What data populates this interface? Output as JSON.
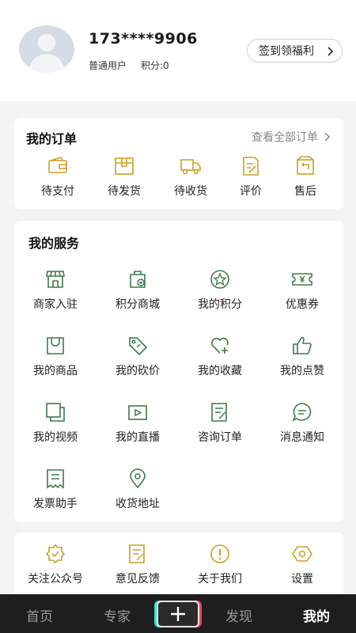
{
  "profile": {
    "phone": "173****9906",
    "role": "普通用户",
    "points": "积分:0",
    "signin_label": "签到领福利"
  },
  "orders": {
    "title": "我的订单",
    "view_all": "查看全部订单",
    "items": [
      {
        "label": "待支付",
        "icon": "wallet-icon"
      },
      {
        "label": "待发货",
        "icon": "box-icon"
      },
      {
        "label": "待收货",
        "icon": "truck-icon"
      },
      {
        "label": "评价",
        "icon": "review-icon"
      },
      {
        "label": "售后",
        "icon": "after-sale-icon"
      }
    ]
  },
  "services": {
    "title": "我的服务",
    "items": [
      {
        "label": "商家入驻",
        "icon": "store-icon"
      },
      {
        "label": "积分商城",
        "icon": "points-mall-icon"
      },
      {
        "label": "我的积分",
        "icon": "star-circle-icon"
      },
      {
        "label": "优惠券",
        "icon": "coupon-icon"
      },
      {
        "label": "我的商品",
        "icon": "bag-icon"
      },
      {
        "label": "我的砍价",
        "icon": "price-tag-icon"
      },
      {
        "label": "我的收藏",
        "icon": "heart-plus-icon"
      },
      {
        "label": "我的点赞",
        "icon": "thumbs-up-icon"
      },
      {
        "label": "我的视频",
        "icon": "video-icon"
      },
      {
        "label": "我的直播",
        "icon": "live-icon"
      },
      {
        "label": "咨询订单",
        "icon": "consult-order-icon"
      },
      {
        "label": "消息通知",
        "icon": "message-icon"
      },
      {
        "label": "发票助手",
        "icon": "invoice-icon"
      },
      {
        "label": "收货地址",
        "icon": "location-icon"
      }
    ]
  },
  "more": {
    "items": [
      {
        "label": "关注公众号",
        "icon": "badge-icon"
      },
      {
        "label": "意见反馈",
        "icon": "feedback-icon"
      },
      {
        "label": "关于我们",
        "icon": "info-icon"
      },
      {
        "label": "设置",
        "icon": "settings-icon"
      }
    ]
  },
  "tabbar": {
    "home": "首页",
    "experts": "专家",
    "discover": "发现",
    "mine": "我的"
  },
  "colors": {
    "gold": "#c9a227",
    "green": "#3f7a4a",
    "tabbar_bg": "#1e1e1e"
  }
}
